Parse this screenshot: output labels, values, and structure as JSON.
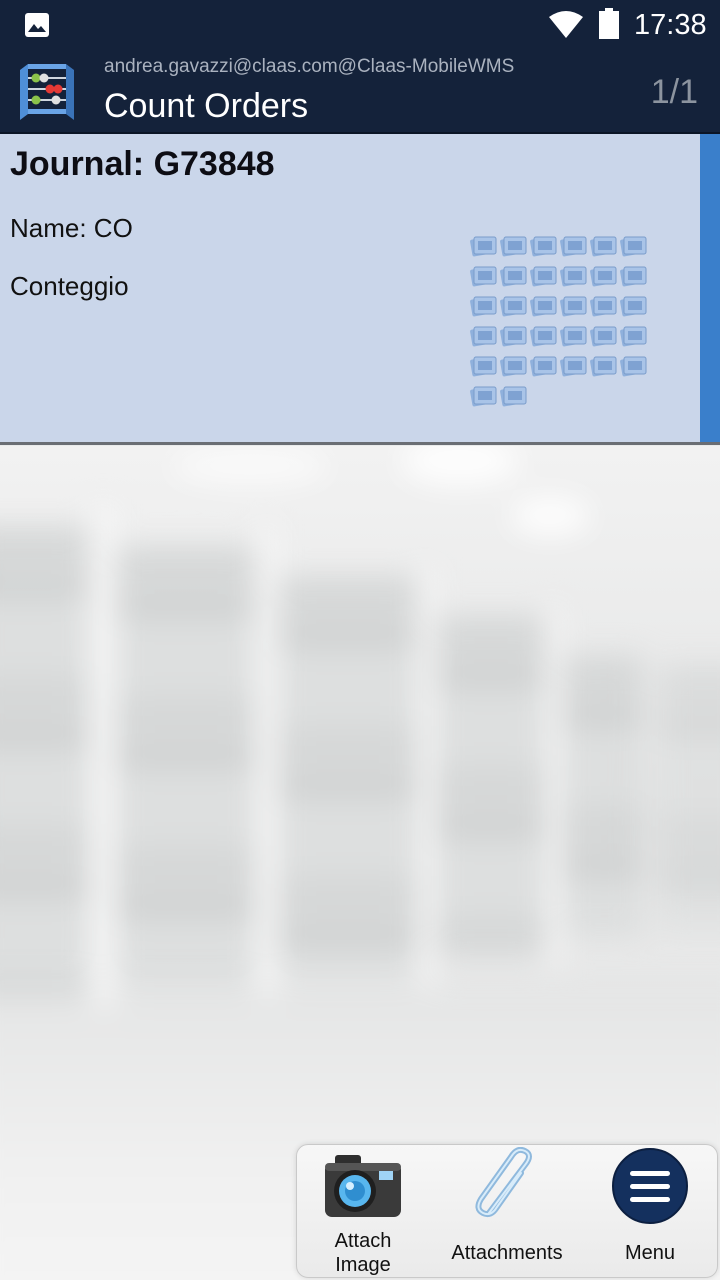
{
  "status_bar": {
    "time": "17:38",
    "icons": [
      "image-icon",
      "wifi-icon",
      "battery-icon"
    ]
  },
  "header": {
    "user": "andrea.gavazzi@claas.com@Claas-MobileWMS",
    "title": "Count Orders",
    "pager": "1/1",
    "logo_icon": "abacus-icon"
  },
  "journal_card": {
    "journal": "Journal: G73848",
    "name": "Name: CO",
    "description": "Conteggio",
    "thumbnail_icon": "photo-stack-icon",
    "accent_color": "#3a7fcb",
    "background_color": "#cad6ea"
  },
  "actions": {
    "attach_image_line1": "Attach",
    "attach_image_line2": "Image",
    "attachments": "Attachments",
    "menu": "Menu",
    "attach_icon": "camera-icon",
    "attachments_icon": "paperclip-icon",
    "menu_icon": "hamburger-menu-icon"
  },
  "colors": {
    "header_bg": "#14223a",
    "menu_button": "#14305e"
  }
}
